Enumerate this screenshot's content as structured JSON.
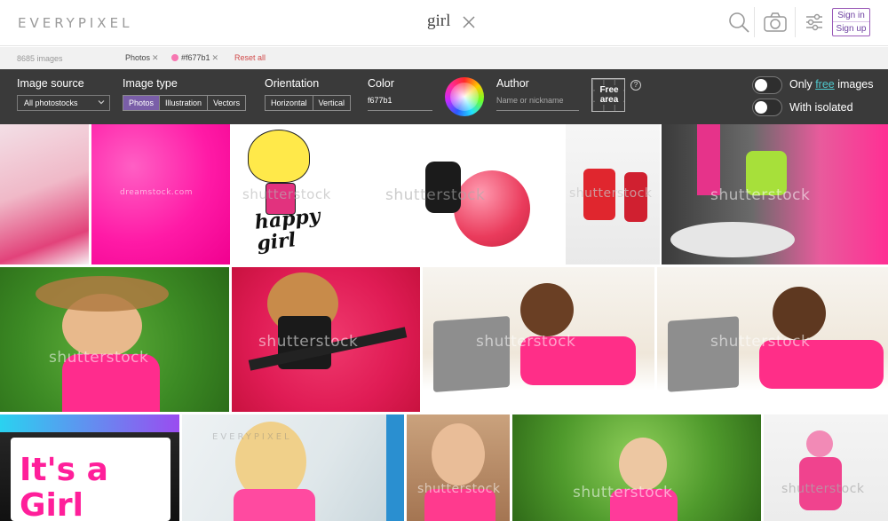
{
  "header": {
    "logo": "EVERYPIXEL",
    "query": "girl",
    "sign_in": "Sign in",
    "sign_up": "Sign up"
  },
  "filter_bar": {
    "count": "8685 images",
    "chips": [
      {
        "label": "Photos"
      },
      {
        "label": "#f677b1",
        "color": "#f677b1"
      }
    ],
    "reset": "Reset all"
  },
  "panel": {
    "image_source": {
      "label": "Image source",
      "value": "All photostocks"
    },
    "image_type": {
      "label": "Image type",
      "options": [
        "Photos",
        "Illustration",
        "Vectors"
      ],
      "selected": "Photos"
    },
    "orientation": {
      "label": "Orientation",
      "options": [
        "Horizontal",
        "Vertical"
      ]
    },
    "color": {
      "label": "Color",
      "value": "f677b1"
    },
    "author": {
      "label": "Author",
      "placeholder": "Name or nickname"
    },
    "free_area": "Free area",
    "help": "?",
    "toggles": [
      {
        "prefix": "Only ",
        "highlight": "free",
        "suffix": " images",
        "on": false
      },
      {
        "label": "With isolated",
        "on": false
      }
    ]
  },
  "results": {
    "watermarks": {
      "dreamstock": "dreamstock.com",
      "shutterstock": "shutterstock",
      "everypixel": "EVERYPIXEL"
    },
    "phrase_lines": [
      "happy",
      "girl"
    ],
    "card_text_lines": [
      "It's a",
      "Girl"
    ]
  },
  "colors": {
    "accent": "#7a5ea8",
    "panel_bg": "#3a3a3a",
    "search_color": "#f677b1",
    "free_link": "#4fc9ce",
    "reset": "#d14b4b"
  }
}
